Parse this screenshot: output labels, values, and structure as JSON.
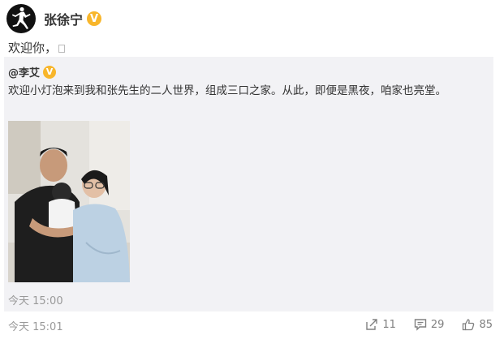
{
  "post": {
    "username": "张徐宁",
    "verified_badge": "V",
    "text": "欢迎你，",
    "timestamp": "今天 15:01"
  },
  "repost": {
    "author": "@李艾",
    "verified_badge": "V",
    "text": "欢迎小灯泡来到我和张先生的二人世界，组成三口之家。从此，即便是黑夜，咱家也亮堂。",
    "timestamp": "今天 15:00"
  },
  "actions": {
    "share_count": "11",
    "comment_count": "29",
    "like_count": "85"
  },
  "icons": {
    "avatar": "jumpman-logo-icon",
    "verified": "verified-v-icon",
    "share": "share-icon",
    "comment": "comment-icon",
    "like": "thumbs-up-icon"
  },
  "colors": {
    "badge": "#f8b62b",
    "repost_background": "#f2f2f5",
    "muted_text": "#999999"
  }
}
